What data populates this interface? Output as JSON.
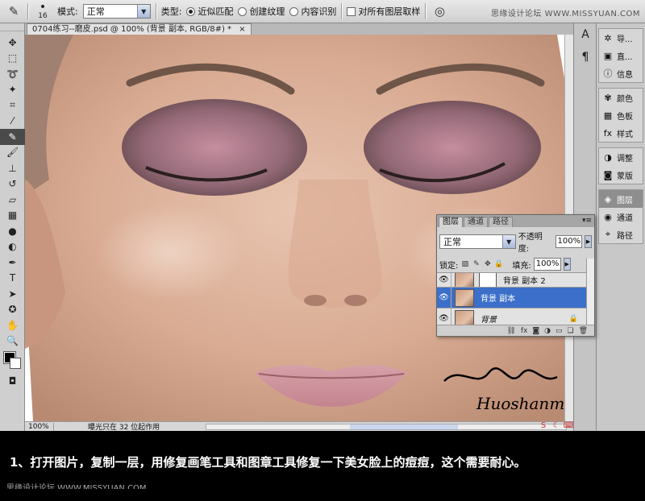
{
  "options_bar": {
    "brush_size": "16",
    "mode_label": "模式:",
    "mode_value": "正常",
    "type_label": "类型:",
    "type_options": [
      "近似匹配",
      "创建纹理",
      "内容识别"
    ],
    "type_selected": "近似匹配",
    "sample_all_layers": "对所有图层取样",
    "watermark": "思缘设计论坛 WWW.MISSYUAN.COM"
  },
  "document": {
    "tab_title": "0704练习--磨皮.psd @ 100% (背景 副本, RGB/8#) *",
    "close": "×",
    "zoom": "100%",
    "status": "曝光只在 32 位起作用"
  },
  "dock": {
    "group1": [
      "导...",
      "直...",
      "信息"
    ],
    "group2": [
      "颜色",
      "色板",
      "样式"
    ],
    "group3": [
      "调整",
      "蒙版"
    ],
    "group4": [
      "图层",
      "通道",
      "路径"
    ],
    "selected": "图层"
  },
  "layers_panel": {
    "tabs": [
      "图层",
      "通道",
      "路径"
    ],
    "blend_mode": "正常",
    "opacity_label": "不透明度:",
    "opacity": "100%",
    "lock_label": "锁定:",
    "fill_label": "填充:",
    "fill": "100%",
    "layers": [
      {
        "name": "背景 副本 2",
        "visible": true,
        "selected": false
      },
      {
        "name": "背景 副本",
        "visible": true,
        "selected": true
      },
      {
        "name": "背景",
        "visible": true,
        "selected": false
      }
    ]
  },
  "signature": "Huoshanmzuo",
  "caption": {
    "text": "1、打开图片，复制一层，用修复画笔工具和图章工具修复一下美女脸上的痘痘，这个需要耐心。",
    "watermark": "思缘设计论坛 WWW.MISSYUAN.COM"
  }
}
